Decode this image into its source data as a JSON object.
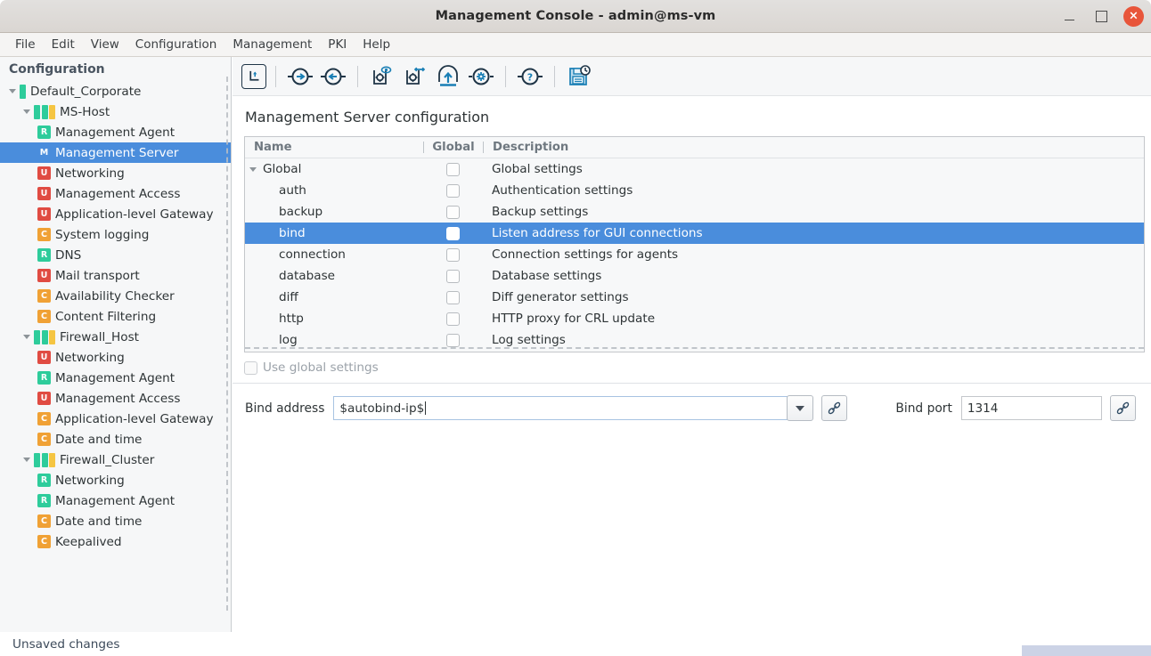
{
  "window": {
    "title": "Management Console - admin@ms-vm",
    "controls": [
      {
        "name": "minimize",
        "glyph": ""
      },
      {
        "name": "maximize",
        "glyph": ""
      },
      {
        "name": "close",
        "glyph": "×"
      }
    ],
    "close_color": "#e8553a"
  },
  "menubar": {
    "items": [
      "File",
      "Edit",
      "View",
      "Configuration",
      "Management",
      "PKI",
      "Help"
    ]
  },
  "toolbar": {
    "buttons": [
      {
        "name": "go-up-icon",
        "tip": "Up"
      },
      {
        "name": "forward-arrow-icon",
        "tip": "Forward"
      },
      {
        "name": "back-arrow-icon",
        "tip": "Back"
      },
      {
        "name": "preview-config-icon",
        "tip": "Preview configuration"
      },
      {
        "name": "transfer-config-icon",
        "tip": "Transfer configuration"
      },
      {
        "name": "upload-icon",
        "tip": "Upload"
      },
      {
        "name": "settings-gear-icon",
        "tip": "Settings"
      },
      {
        "name": "help-icon",
        "tip": "Help"
      },
      {
        "name": "save-history-icon",
        "tip": "Save history"
      }
    ]
  },
  "sidebar": {
    "title": "Configuration",
    "items": [
      {
        "label": "Default_Corporate",
        "level": 0,
        "twist": true,
        "icon": "onebar",
        "badge": ""
      },
      {
        "label": "MS-Host",
        "level": 1,
        "twist": true,
        "icon": "hostbars",
        "badge": ""
      },
      {
        "label": "Management Agent",
        "level": 2,
        "twist": false,
        "icon": "badge",
        "badge": "R"
      },
      {
        "label": "Management Server",
        "level": 2,
        "twist": false,
        "icon": "badge",
        "badge": "M",
        "selected": true
      },
      {
        "label": "Networking",
        "level": 2,
        "twist": false,
        "icon": "badge",
        "badge": "U"
      },
      {
        "label": "Management Access",
        "level": 2,
        "twist": false,
        "icon": "badge",
        "badge": "U"
      },
      {
        "label": "Application-level Gateway",
        "level": 2,
        "twist": false,
        "icon": "badge",
        "badge": "U"
      },
      {
        "label": "System logging",
        "level": 2,
        "twist": false,
        "icon": "badge",
        "badge": "C"
      },
      {
        "label": "DNS",
        "level": 2,
        "twist": false,
        "icon": "badge",
        "badge": "R"
      },
      {
        "label": "Mail transport",
        "level": 2,
        "twist": false,
        "icon": "badge",
        "badge": "U"
      },
      {
        "label": "Availability Checker",
        "level": 2,
        "twist": false,
        "icon": "badge",
        "badge": "C"
      },
      {
        "label": "Content Filtering",
        "level": 2,
        "twist": false,
        "icon": "badge",
        "badge": "C"
      },
      {
        "label": "Firewall_Host",
        "level": 1,
        "twist": true,
        "icon": "hostbars",
        "badge": ""
      },
      {
        "label": "Networking",
        "level": 2,
        "twist": false,
        "icon": "badge",
        "badge": "U"
      },
      {
        "label": "Management Agent",
        "level": 2,
        "twist": false,
        "icon": "badge",
        "badge": "R"
      },
      {
        "label": "Management Access",
        "level": 2,
        "twist": false,
        "icon": "badge",
        "badge": "U"
      },
      {
        "label": "Application-level Gateway",
        "level": 2,
        "twist": false,
        "icon": "badge",
        "badge": "C"
      },
      {
        "label": "Date and time",
        "level": 2,
        "twist": false,
        "icon": "badge",
        "badge": "C"
      },
      {
        "label": "Firewall_Cluster",
        "level": 1,
        "twist": true,
        "icon": "hostbars",
        "badge": ""
      },
      {
        "label": "Networking",
        "level": 2,
        "twist": false,
        "icon": "badge",
        "badge": "R"
      },
      {
        "label": "Management Agent",
        "level": 2,
        "twist": false,
        "icon": "badge",
        "badge": "R"
      },
      {
        "label": "Date and time",
        "level": 2,
        "twist": false,
        "icon": "badge",
        "badge": "C"
      },
      {
        "label": "Keepalived",
        "level": 2,
        "twist": false,
        "icon": "badge",
        "badge": "C"
      }
    ],
    "badge_colors": {
      "R": "#2ecc9b",
      "M": "#4a8ddc",
      "U": "#e04b42",
      "C": "#f0a135"
    }
  },
  "main": {
    "page_title": "Management Server configuration",
    "table": {
      "columns": [
        "Name",
        "Global",
        "Description"
      ],
      "rows": [
        {
          "name": "Global",
          "level": 0,
          "twist": true,
          "global": false,
          "description": "Global settings"
        },
        {
          "name": "auth",
          "level": 1,
          "twist": false,
          "global": false,
          "description": "Authentication settings"
        },
        {
          "name": "backup",
          "level": 1,
          "twist": false,
          "global": false,
          "description": "Backup settings"
        },
        {
          "name": "bind",
          "level": 1,
          "twist": false,
          "global": false,
          "description": "Listen address for GUI connections",
          "selected": true
        },
        {
          "name": "connection",
          "level": 1,
          "twist": false,
          "global": false,
          "description": "Connection settings for agents"
        },
        {
          "name": "database",
          "level": 1,
          "twist": false,
          "global": false,
          "description": "Database settings"
        },
        {
          "name": "diff",
          "level": 1,
          "twist": false,
          "global": false,
          "description": "Diff generator settings"
        },
        {
          "name": "http",
          "level": 1,
          "twist": false,
          "global": false,
          "description": "HTTP proxy for CRL update"
        },
        {
          "name": "log",
          "level": 1,
          "twist": false,
          "global": false,
          "description": "Log settings"
        }
      ]
    },
    "use_global": {
      "label": "Use global settings",
      "checked": false,
      "enabled": false
    },
    "form": {
      "bind_address": {
        "label": "Bind address",
        "value": "$autobind-ip$",
        "placeholder": ""
      },
      "bind_port": {
        "label": "Bind port",
        "value": "1314",
        "placeholder": ""
      }
    }
  },
  "statusbar": {
    "text": "Unsaved changes",
    "progress_color": "#ccd3e6"
  },
  "colors": {
    "selection": "#4a8ddc",
    "accent_icon": "#1a7fb5",
    "icon_dark": "#1f3547"
  }
}
